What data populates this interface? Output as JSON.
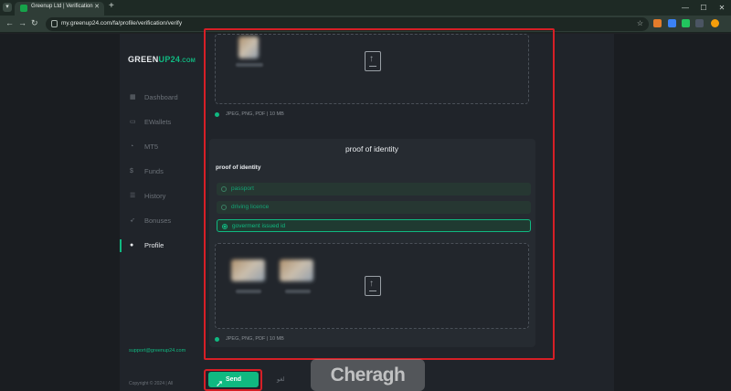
{
  "browser": {
    "tab_title": "Greenup Ltd | Verification",
    "url": "my.greenup24.com/fa/profile/verification/verify"
  },
  "sidebar": {
    "logo_main": "GREEN",
    "logo_accent": "UP24",
    "logo_tld": ".COM",
    "items": [
      {
        "label": "Dashboard",
        "icon": "grid-icon"
      },
      {
        "label": "EWallets",
        "icon": "wallet-icon"
      },
      {
        "label": "MT5",
        "icon": "chart-icon"
      },
      {
        "label": "Funds",
        "icon": "dollar-icon"
      },
      {
        "label": "History",
        "icon": "list-icon"
      },
      {
        "label": "Bonuses",
        "icon": "rocket-icon"
      },
      {
        "label": "Profile",
        "icon": "user-icon"
      }
    ],
    "support_email": "support@greenup24.com",
    "copyright": "Copyright © 2024 | All"
  },
  "upload_top": {
    "note": "JPEG, PNG, PDF | 10 MB"
  },
  "identity": {
    "section_title": "proof of identity",
    "field_label": "proof of identity",
    "options": [
      "passport",
      "driving licence",
      "goverment issued id"
    ],
    "selected": "goverment issued id",
    "note": "JPEG, PNG, PDF | 10 MB"
  },
  "actions": {
    "send_label": "Send",
    "cancel_label": "لغو"
  },
  "watermark": "Cheragh",
  "colors": {
    "accent": "#10b981",
    "highlight_frame": "#d61f26",
    "background": "#20242a"
  }
}
